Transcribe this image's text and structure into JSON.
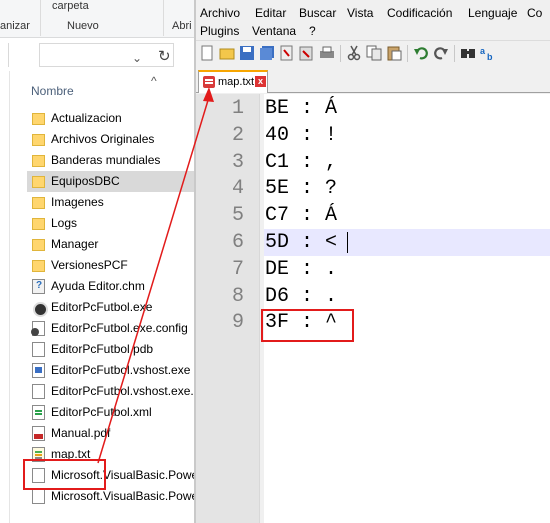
{
  "explorer": {
    "ribbon": {
      "carpeta_label": "carpeta",
      "nuevo_label": "Nuevo",
      "organizar_label": "anizar",
      "abrir_label": "Abri"
    },
    "column_header": "Nombre",
    "files": [
      {
        "name": "Actualizacion",
        "type": "folder"
      },
      {
        "name": "Archivos Originales",
        "type": "folder"
      },
      {
        "name": "Banderas mundiales",
        "type": "folder"
      },
      {
        "name": "EquiposDBC",
        "type": "folder",
        "selected": true
      },
      {
        "name": "Imagenes",
        "type": "folder"
      },
      {
        "name": "Logs",
        "type": "folder"
      },
      {
        "name": "Manager",
        "type": "folder"
      },
      {
        "name": "VersionesPCF",
        "type": "folder"
      },
      {
        "name": "Ayuda Editor.chm",
        "type": "chm"
      },
      {
        "name": "EditorPcFutbol.exe",
        "type": "exe"
      },
      {
        "name": "EditorPcFutbol.exe.config",
        "type": "cfg"
      },
      {
        "name": "EditorPcFutbol.pdb",
        "type": "doc"
      },
      {
        "name": "EditorPcFutbol.vshost.exe",
        "type": "vsh"
      },
      {
        "name": "EditorPcFutbol.vshost.exe.",
        "type": "doc"
      },
      {
        "name": "EditorPcFutbol.xml",
        "type": "xml"
      },
      {
        "name": "Manual.pdf",
        "type": "pdf"
      },
      {
        "name": "map.txt",
        "type": "txt",
        "highlighted": true
      },
      {
        "name": "Microsoft.VisualBasic.Powe",
        "type": "dll"
      },
      {
        "name": "Microsoft.VisualBasic.Powe",
        "type": "dll"
      }
    ]
  },
  "notepadpp": {
    "menu": [
      "Archivo",
      "Editar",
      "Buscar",
      "Vista",
      "Codificación",
      "Lenguaje",
      "Co",
      "Plugins",
      "Ventana",
      "?"
    ],
    "tab": {
      "label": "map.txt",
      "close": "x"
    },
    "current_line": 6,
    "lines": [
      {
        "num": "1",
        "text": "BE : Á"
      },
      {
        "num": "2",
        "text": "40 : !"
      },
      {
        "num": "3",
        "text": "C1 : ,"
      },
      {
        "num": "4",
        "text": "5E : ?"
      },
      {
        "num": "5",
        "text": "C7 : Á"
      },
      {
        "num": "6",
        "text": "5D : <"
      },
      {
        "num": "7",
        "text": "DE : ."
      },
      {
        "num": "8",
        "text": "D6 : ."
      },
      {
        "num": "9",
        "text": "3F : ^"
      }
    ]
  },
  "colors": {
    "annotation_red": "#e21b1b",
    "current_line_bg": "#e8e8ff",
    "tab_accent": "#f7a500",
    "selected_row": "#d9d9d9"
  }
}
